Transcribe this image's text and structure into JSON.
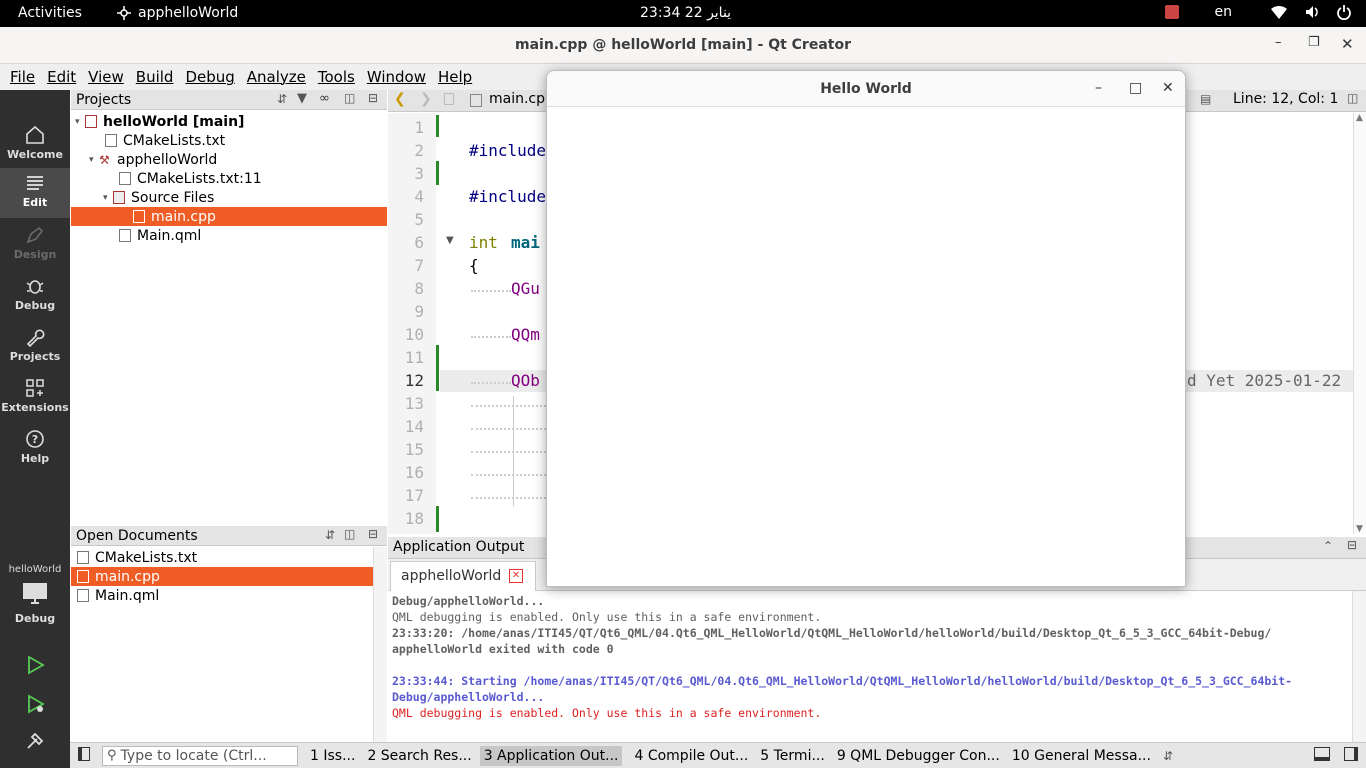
{
  "topbar": {
    "activities": "Activities",
    "app_name": "apphelloWorld",
    "clock": "23:34  22 يناير",
    "lang": "en"
  },
  "window": {
    "title": "main.cpp @ helloWorld [main] - Qt Creator"
  },
  "menu": [
    "File",
    "Edit",
    "View",
    "Build",
    "Debug",
    "Analyze",
    "Tools",
    "Window",
    "Help"
  ],
  "modes": [
    {
      "label": "Welcome",
      "icon": "home-icon"
    },
    {
      "label": "Edit",
      "icon": "edit-icon"
    },
    {
      "label": "Design",
      "icon": "pen-icon"
    },
    {
      "label": "Debug",
      "icon": "bug-icon"
    },
    {
      "label": "Projects",
      "icon": "wrench-icon"
    },
    {
      "label": "Extensions",
      "icon": "extensions-icon"
    },
    {
      "label": "Help",
      "icon": "help-icon"
    }
  ],
  "kit": {
    "project": "helloWorld",
    "label": "Debug"
  },
  "projects_pane": {
    "title": "Projects",
    "tree": [
      "helloWorld [main]",
      "CMakeLists.txt",
      "apphelloWorld",
      "CMakeLists.txt:11",
      "Source Files",
      "main.cpp",
      "Main.qml"
    ]
  },
  "open_docs": {
    "title": "Open Documents",
    "items": [
      "CMakeLists.txt",
      "main.cpp",
      "Main.qml"
    ]
  },
  "editor": {
    "tab": "main.cpp",
    "position": "Line: 12, Col: 1",
    "line_numbers": [
      "1",
      "2",
      "3",
      "4",
      "5",
      "6",
      "7",
      "8",
      "9",
      "10",
      "11",
      "12",
      "13",
      "14",
      "15",
      "16",
      "17",
      "18"
    ],
    "code": {
      "l2": "#include",
      "l4": "#include",
      "l6a": "int",
      "l6b": "mai",
      "l7": "{",
      "l8": "QGu",
      "l10": "QQm",
      "l12": "QOb",
      "blame": "d Yet 2025-01-22"
    }
  },
  "output": {
    "header": "Application Output",
    "tab": "apphelloWorld",
    "lines": [
      "Debug/apphelloWorld...",
      "QML debugging is enabled. Only use this in a safe environment.",
      "23:33:20: /home/anas/ITI45/QT/Qt6_QML/04.Qt6_QML_HelloWorld/QtQML_HelloWorld/helloWorld/build/Desktop_Qt_6_5_3_GCC_64bit-Debug/",
      "apphelloWorld exited with code 0",
      "23:33:44: Starting /home/anas/ITI45/QT/Qt6_QML/04.Qt6_QML_HelloWorld/QtQML_HelloWorld/helloWorld/build/Desktop_Qt_6_5_3_GCC_64bit-",
      "Debug/apphelloWorld...",
      "QML debugging is enabled. Only use this in a safe environment."
    ]
  },
  "statusbar": {
    "locator_placeholder": "Type to locate (Ctrl...",
    "tabs": [
      "1  Iss...",
      "2  Search Res...",
      "3  Application Out...",
      "4  Compile Out...",
      "5  Termi...",
      "9  QML Debugger Con...",
      "10 General Messa..."
    ]
  },
  "hello_window": {
    "title": "Hello World"
  },
  "colors": {
    "accent": "#ef5c25",
    "modebar": "#2f2f2f",
    "output_blue": "#5a5ad0",
    "output_red": "#dd2222"
  }
}
